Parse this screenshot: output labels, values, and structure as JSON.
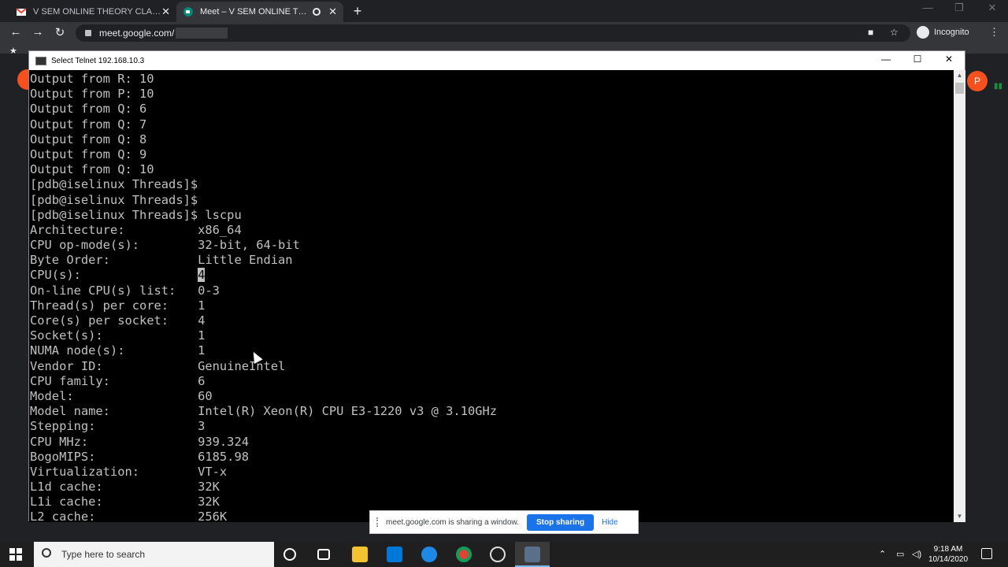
{
  "browser": {
    "tabs": [
      {
        "title": "V SEM ONLINE THEORY CLASSES",
        "favicon": "gmail-icon",
        "active": false
      },
      {
        "title": "Meet – V SEM ONLINE THEORY",
        "favicon": "meet-icon",
        "active": true
      }
    ],
    "url": "meet.google.com/",
    "profile_label": "Incognito"
  },
  "meet": {
    "avatar_letter": "P"
  },
  "telnet": {
    "title": "Select Telnet 192.168.10.3",
    "lines": [
      "Output from R: 10",
      "Output from P: 10",
      "Output from Q: 6",
      "Output from Q: 7",
      "Output from Q: 8",
      "Output from Q: 9",
      "Output from Q: 10",
      "[pdb@iselinux Threads]$",
      "[pdb@iselinux Threads]$",
      "[pdb@iselinux Threads]$ lscpu",
      "Architecture:          x86_64",
      "CPU op-mode(s):        32-bit, 64-bit",
      "Byte Order:            Little Endian",
      "CPU(s):                ",
      "On-line CPU(s) list:   0-3",
      "Thread(s) per core:    1",
      "Core(s) per socket:    4",
      "Socket(s):             1",
      "NUMA node(s):          1",
      "Vendor ID:             GenuineIntel",
      "CPU family:            6",
      "Model:                 60",
      "Model name:            Intel(R) Xeon(R) CPU E3-1220 v3 @ 3.10GHz",
      "Stepping:              3",
      "CPU MHz:               939.324",
      "BogoMIPS:              6185.98",
      "Virtualization:        VT-x",
      "L1d cache:             32K",
      "L1i cache:             32K",
      "L2 cache:              256K"
    ],
    "cursor_value": "4"
  },
  "sharing": {
    "message": "meet.google.com is sharing a window.",
    "stop_label": "Stop sharing",
    "hide_label": "Hide"
  },
  "taskbar": {
    "search_placeholder": "Type here to search",
    "time": "9:18 AM",
    "date": "10/14/2020"
  }
}
